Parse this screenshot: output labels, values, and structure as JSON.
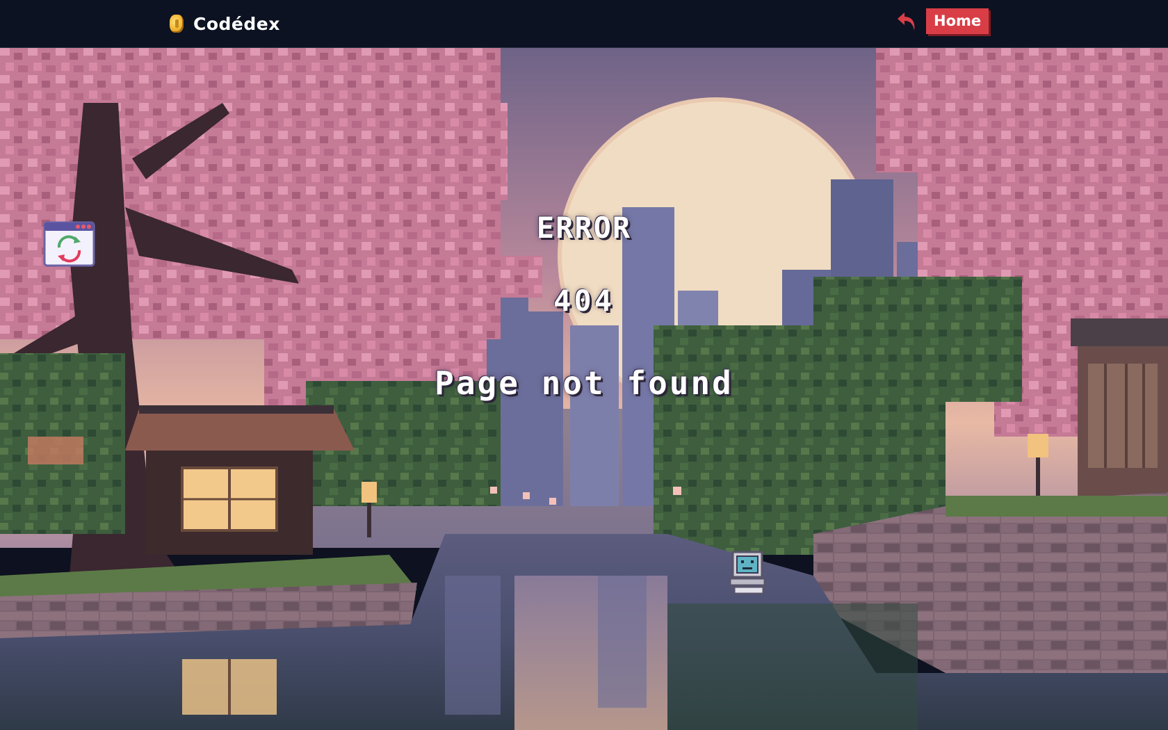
{
  "nav": {
    "brand_name": "Codédex",
    "logo_icon": "coin-icon",
    "back_icon": "undo-arrow-icon",
    "home_label": "Home"
  },
  "error": {
    "title": "ERROR",
    "code": "404",
    "message": "Page not found"
  },
  "widgets": {
    "refresh_icon": "browser-refresh-icon",
    "computer_icon": "retro-computer-icon"
  },
  "colors": {
    "nav_bg": "#0c1222",
    "home_button": "#d93e47",
    "sky_top": "#6e6387",
    "sky_bottom": "#e8b9a4",
    "blossom": "#c57a96",
    "water": "#4a4f6e"
  }
}
